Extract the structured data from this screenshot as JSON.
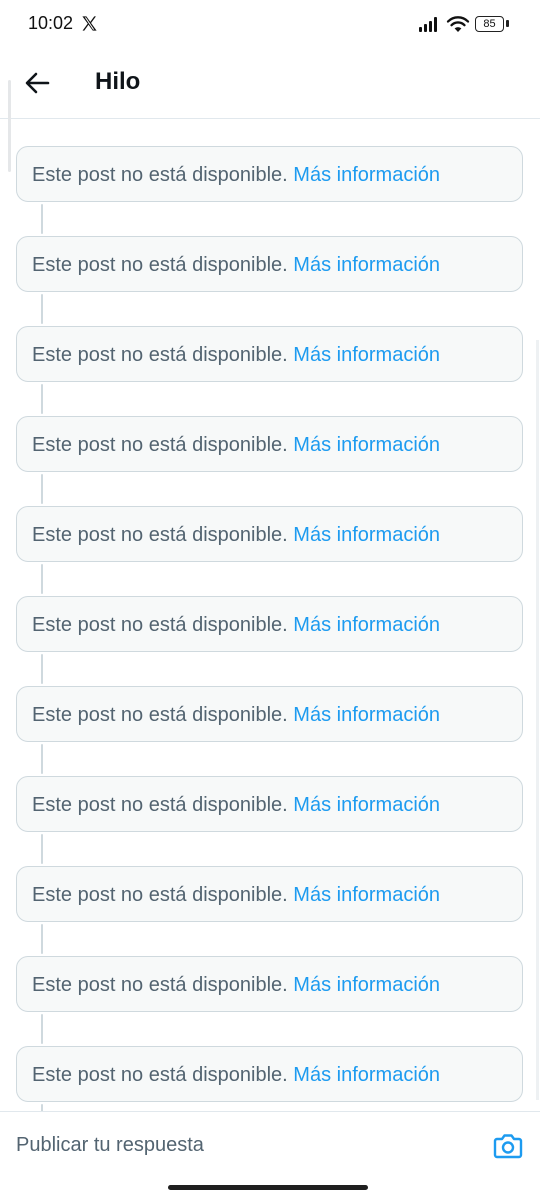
{
  "status_bar": {
    "time": "10:02",
    "app_icon": "x-logo-icon",
    "battery": "85"
  },
  "header": {
    "back_icon": "arrow-left-icon",
    "title": "Hilo"
  },
  "thread": {
    "posts": [
      {
        "message": "Este post no está disponible.",
        "link": "Más información"
      },
      {
        "message": "Este post no está disponible.",
        "link": "Más información"
      },
      {
        "message": "Este post no está disponible.",
        "link": "Más información"
      },
      {
        "message": "Este post no está disponible.",
        "link": "Más información"
      },
      {
        "message": "Este post no está disponible.",
        "link": "Más información"
      },
      {
        "message": "Este post no está disponible.",
        "link": "Más información"
      },
      {
        "message": "Este post no está disponible.",
        "link": "Más información"
      },
      {
        "message": "Este post no está disponible.",
        "link": "Más información"
      },
      {
        "message": "Este post no está disponible.",
        "link": "Más información"
      },
      {
        "message": "Este post no está disponible.",
        "link": "Más información"
      },
      {
        "message": "Este post no está disponible.",
        "link": "Más información"
      }
    ]
  },
  "reply_bar": {
    "placeholder": "Publicar tu respuesta",
    "camera_icon": "camera-icon"
  },
  "colors": {
    "accent": "#1d9bf0",
    "muted_text": "#536471",
    "card_background": "#f7f9f9",
    "border": "#cfd9de"
  }
}
